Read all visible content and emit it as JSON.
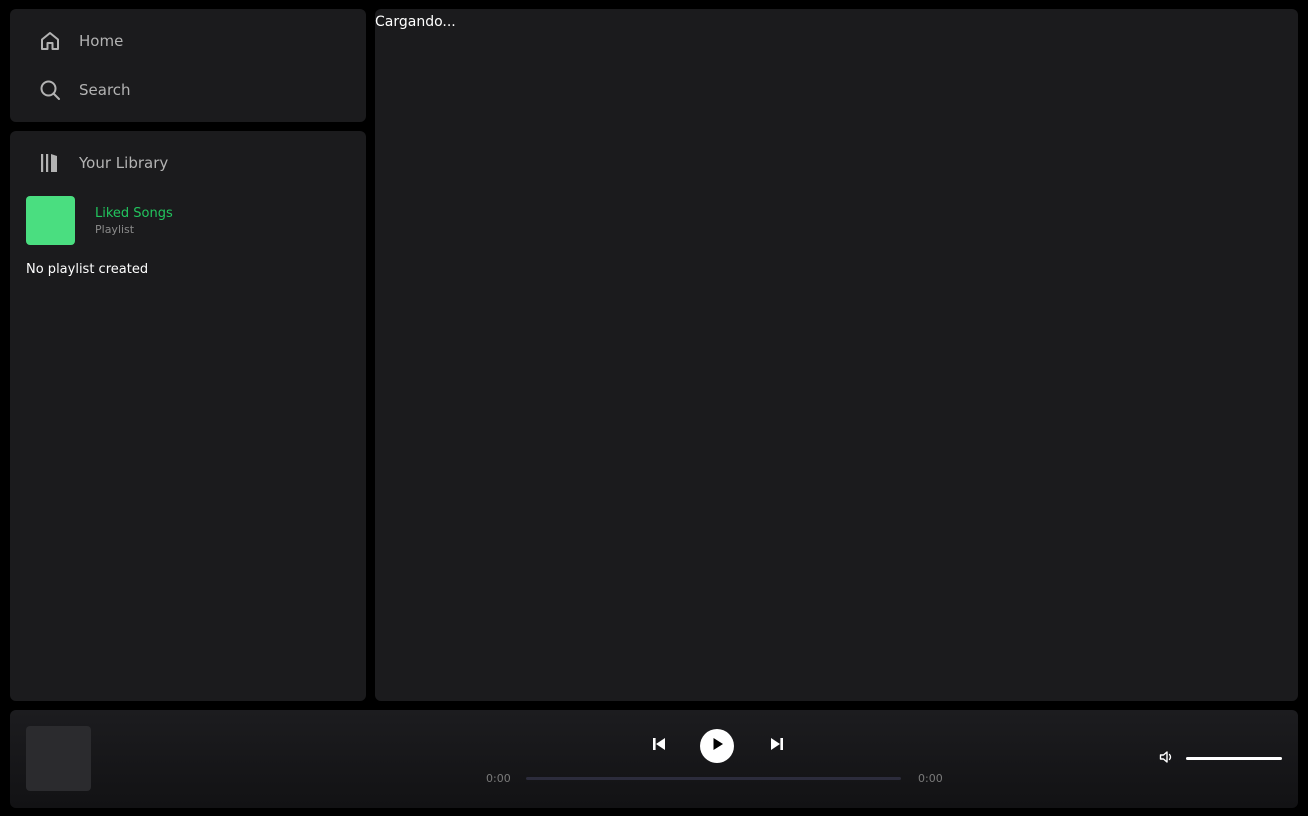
{
  "sidebar": {
    "nav": [
      {
        "label": "Home",
        "icon": "home-icon"
      },
      {
        "label": "Search",
        "icon": "search-icon"
      }
    ],
    "library": {
      "label": "Your Library",
      "icon": "library-icon",
      "liked": {
        "title": "Liked Songs",
        "subtitle": "Playlist",
        "cover_color": "#4ade80"
      },
      "empty_message": "No playlist created"
    }
  },
  "main": {
    "loading_text": "Cargando..."
  },
  "player": {
    "current_time": "0:00",
    "total_time": "0:00",
    "progress": 0,
    "volume": 1.0,
    "icons": {
      "prev": "skip-back-icon",
      "play": "play-icon",
      "next": "skip-forward-icon",
      "volume": "volume-icon"
    }
  },
  "colors": {
    "accent": "#22c55e",
    "panel": "#1b1b1d",
    "background": "#000000"
  }
}
